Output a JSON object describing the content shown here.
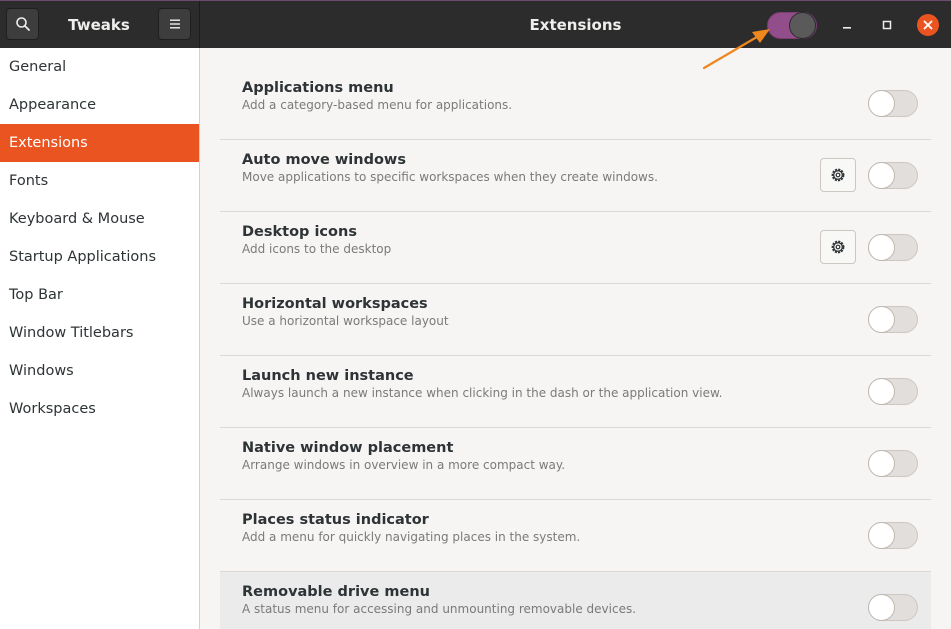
{
  "header": {
    "app_title": "Tweaks",
    "window_title": "Extensions",
    "extensions_enabled": true
  },
  "sidebar": {
    "items": [
      {
        "label": "General"
      },
      {
        "label": "Appearance"
      },
      {
        "label": "Extensions",
        "selected": true
      },
      {
        "label": "Fonts"
      },
      {
        "label": "Keyboard & Mouse"
      },
      {
        "label": "Startup Applications"
      },
      {
        "label": "Top Bar"
      },
      {
        "label": "Window Titlebars"
      },
      {
        "label": "Windows"
      },
      {
        "label": "Workspaces"
      }
    ]
  },
  "extensions": [
    {
      "name": "Applications menu",
      "description": "Add a category-based menu for applications.",
      "has_settings": false,
      "enabled": false
    },
    {
      "name": "Auto move windows",
      "description": "Move applications to specific workspaces when they create windows.",
      "has_settings": true,
      "enabled": false
    },
    {
      "name": "Desktop icons",
      "description": "Add icons to the desktop",
      "has_settings": true,
      "enabled": false
    },
    {
      "name": "Horizontal workspaces",
      "description": "Use a horizontal workspace layout",
      "has_settings": false,
      "enabled": false
    },
    {
      "name": "Launch new instance",
      "description": "Always launch a new instance when clicking in the dash or the application view.",
      "has_settings": false,
      "enabled": false
    },
    {
      "name": "Native window placement",
      "description": "Arrange windows in overview in a more compact way.",
      "has_settings": false,
      "enabled": false
    },
    {
      "name": "Places status indicator",
      "description": "Add a menu for quickly navigating places in the system.",
      "has_settings": false,
      "enabled": false
    },
    {
      "name": "Removable drive menu",
      "description": "A status menu for accessing and unmounting removable devices.",
      "has_settings": false,
      "enabled": false
    }
  ],
  "colors": {
    "accent": "#e95420",
    "switch_on": "#924d8b",
    "annotation_arrow": "#f0861e"
  }
}
